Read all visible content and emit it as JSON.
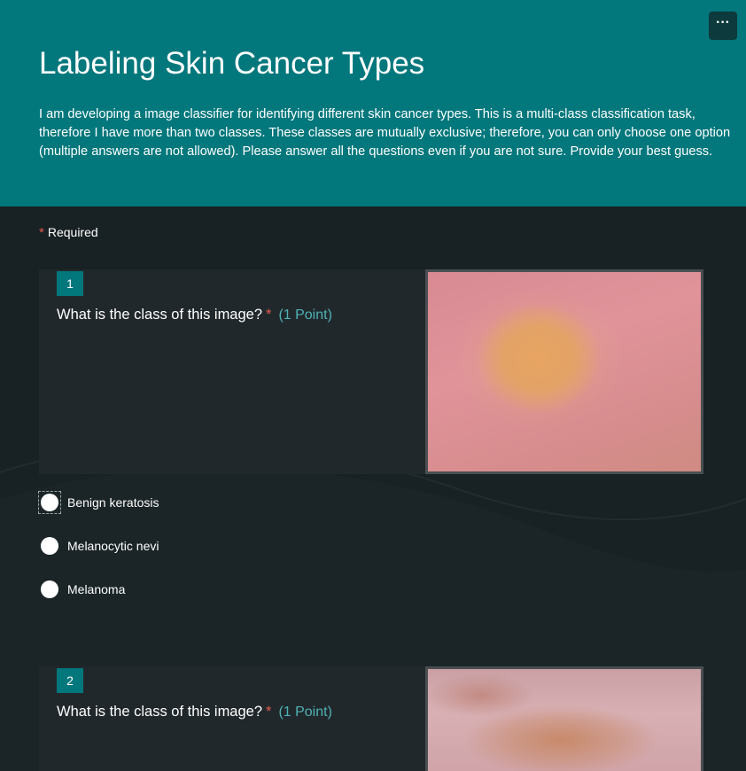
{
  "header": {
    "title": "Labeling Skin Cancer Types",
    "description": "I am developing a image classifier for identifying different skin cancer types. This is a multi-class classification task, therefore I have more than two classes. These classes are mutually exclusive; therefore, you can only choose one option (multiple answers are not allowed). Please answer all the questions even if you are not sure. Provide your best guess.",
    "more_icon": "more-horizontal-icon",
    "more_label": "···"
  },
  "required_note": {
    "star": "*",
    "text": "Required"
  },
  "questions": [
    {
      "number": "1",
      "text": "What is the class of this image?",
      "required_star": "*",
      "points": "(1 Point)",
      "options": [
        {
          "label": "Benign keratosis",
          "selected": false
        },
        {
          "label": "Melanocytic nevi",
          "selected": false
        },
        {
          "label": "Melanoma",
          "selected": false
        }
      ]
    },
    {
      "number": "2",
      "text": "What is the class of this image?",
      "required_star": "*",
      "points": "(1 Point)"
    }
  ],
  "colors": {
    "header_bg": "#02777c",
    "page_bg": "#182123",
    "card_bg": "#21282b",
    "required": "#e05a4e",
    "points": "#4fb2b6"
  }
}
